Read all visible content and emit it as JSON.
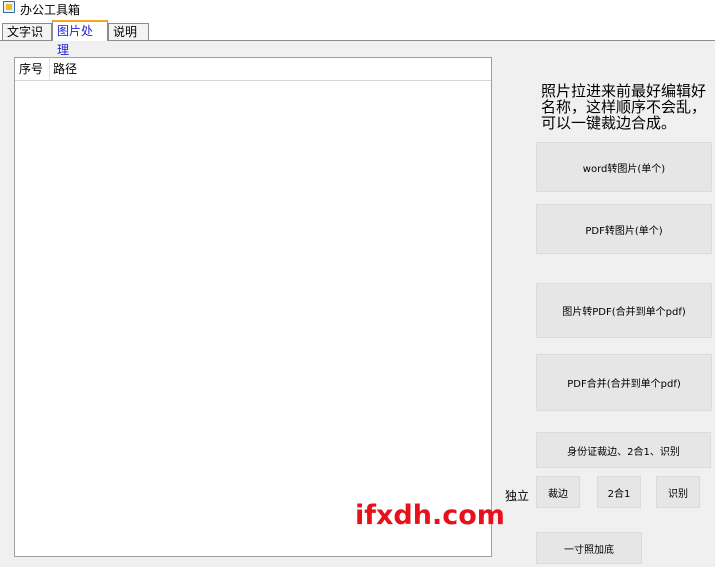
{
  "window": {
    "title": "办公工具箱"
  },
  "tabs": [
    {
      "label": "文字识别"
    },
    {
      "label": "图片处理"
    },
    {
      "label": "说明"
    }
  ],
  "list": {
    "columns": [
      "序号",
      "路径"
    ]
  },
  "hint": "照片拉进来前最好编辑好名称，这样顺序不会乱，可以一键裁边合成。",
  "buttons": {
    "word_to_image": "word转图片(单个)",
    "pdf_to_image": "PDF转图片(单个)",
    "image_to_pdf": "图片转PDF(合并到单个pdf)",
    "pdf_merge": "PDF合并(合并到单个pdf)",
    "idcard_all": "身份证裁边、2合1、识别",
    "crop": "裁边",
    "two_in_one": "2合1",
    "recognize": "识别",
    "one_inch_bg": "一寸照加底"
  },
  "labels": {
    "independent": "独立"
  },
  "watermark": "ifxdh.com"
}
